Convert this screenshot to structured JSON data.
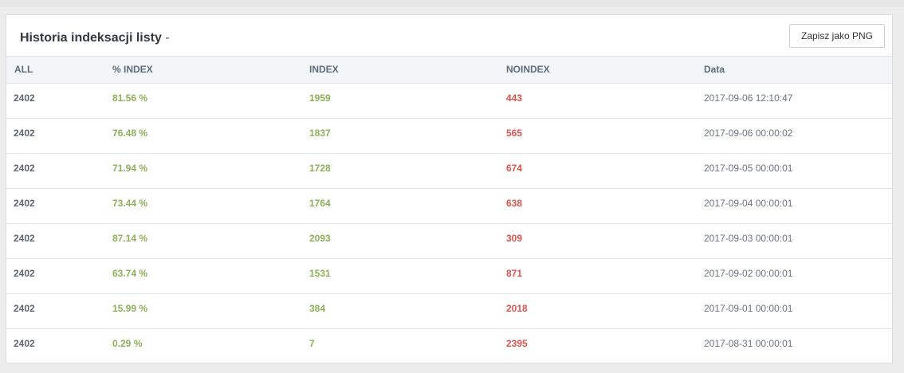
{
  "panel": {
    "title": "Historia indeksacji listy",
    "title_separator": " - ",
    "save_button_label": "Zapisz jako PNG"
  },
  "table": {
    "columns": [
      "ALL",
      "% INDEX",
      "INDEX",
      "NOINDEX",
      "Data"
    ],
    "rows": [
      {
        "all": "2402",
        "pct": "81.56 %",
        "index": "1959",
        "noindex": "443",
        "date": "2017-09-06 12:10:47"
      },
      {
        "all": "2402",
        "pct": "76.48 %",
        "index": "1837",
        "noindex": "565",
        "date": "2017-09-06 00:00:02"
      },
      {
        "all": "2402",
        "pct": "71.94 %",
        "index": "1728",
        "noindex": "674",
        "date": "2017-09-05 00:00:01"
      },
      {
        "all": "2402",
        "pct": "73.44 %",
        "index": "1764",
        "noindex": "638",
        "date": "2017-09-04 00:00:01"
      },
      {
        "all": "2402",
        "pct": "87.14 %",
        "index": "2093",
        "noindex": "309",
        "date": "2017-09-03 00:00:01"
      },
      {
        "all": "2402",
        "pct": "63.74 %",
        "index": "1531",
        "noindex": "871",
        "date": "2017-09-02 00:00:01"
      },
      {
        "all": "2402",
        "pct": "15.99 %",
        "index": "384",
        "noindex": "2018",
        "date": "2017-09-01 00:00:01"
      },
      {
        "all": "2402",
        "pct": "0.29 %",
        "index": "7",
        "noindex": "2395",
        "date": "2017-08-31 00:00:01"
      }
    ]
  },
  "colors": {
    "positive": "#8cb05a",
    "negative": "#d9534f",
    "header_bg": "#f3f6f9"
  }
}
